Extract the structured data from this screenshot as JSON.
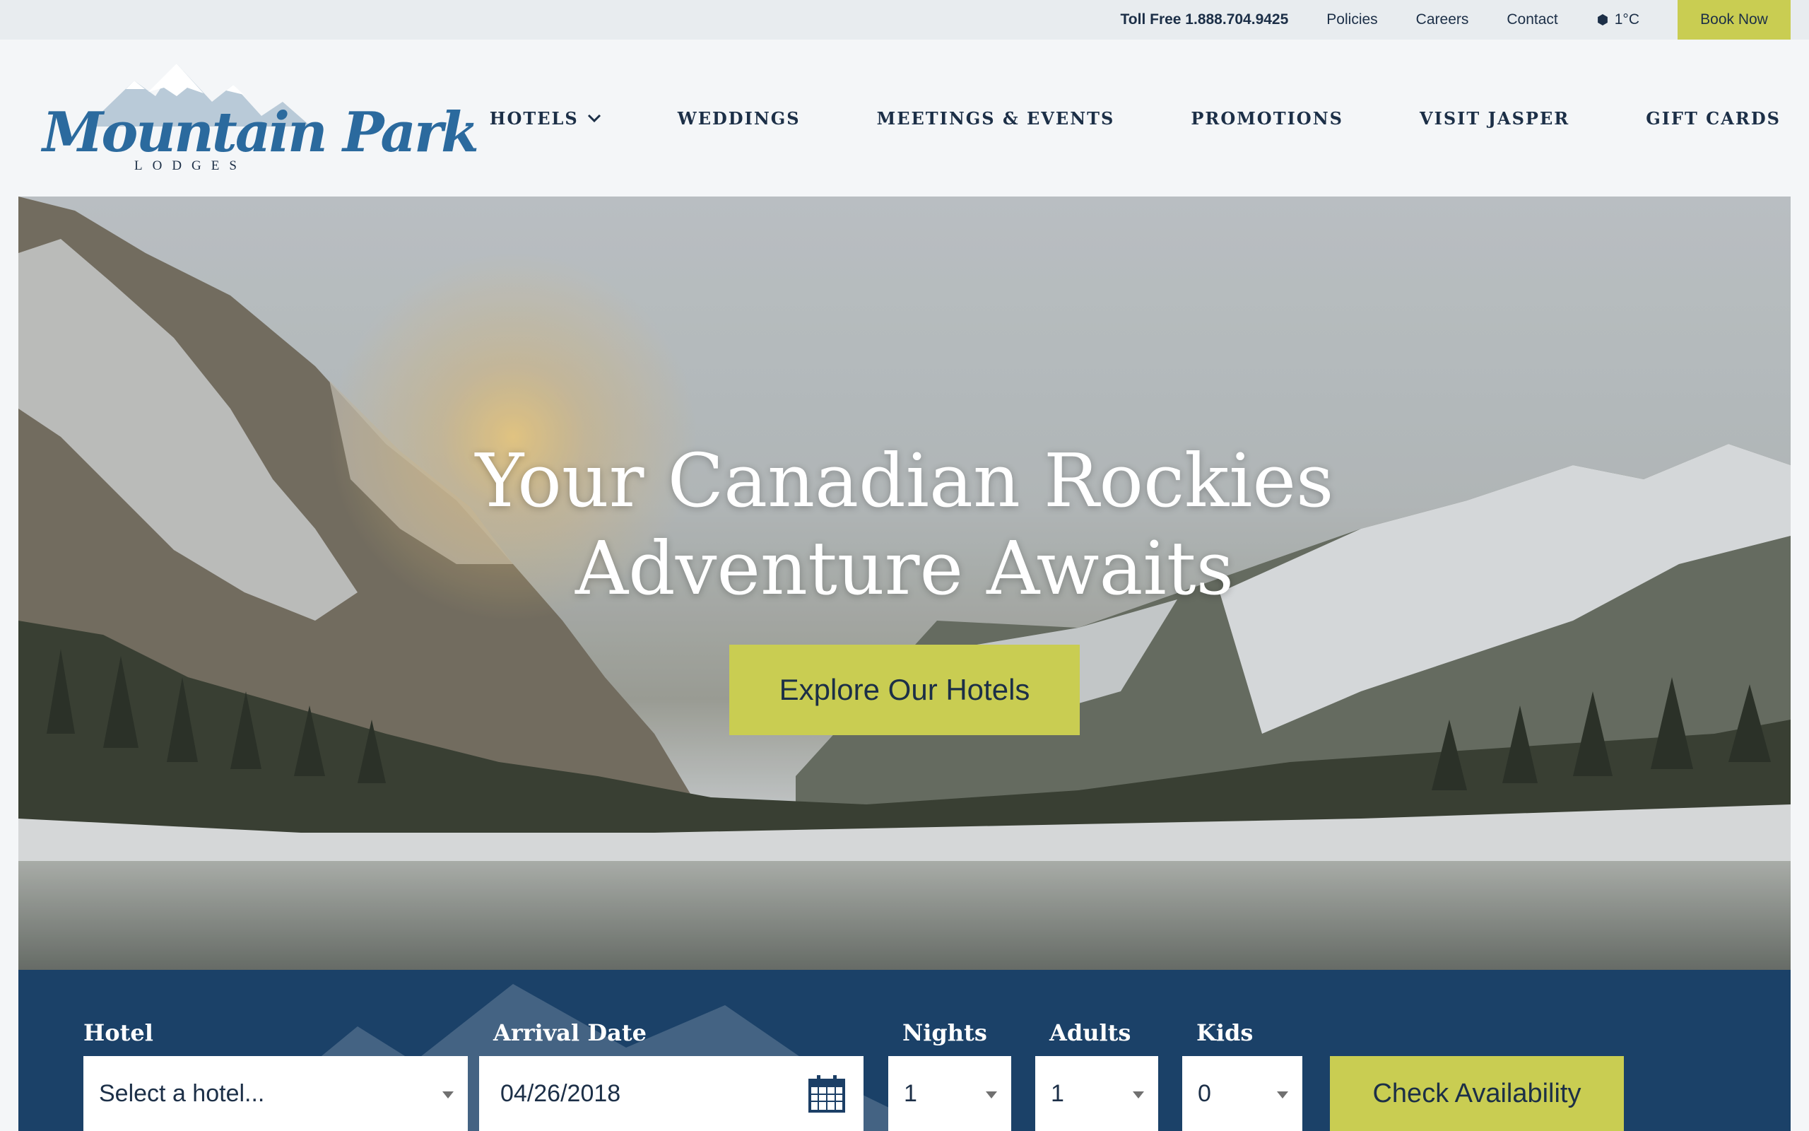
{
  "topbar": {
    "toll_free": "Toll Free 1.888.704.9425",
    "policies": "Policies",
    "careers": "Careers",
    "contact": "Contact",
    "weather": "1°C",
    "book_now": "Book Now"
  },
  "logo": {
    "script": "Mountain Park",
    "sub": "LODGES"
  },
  "nav": {
    "hotels": "HOTELS",
    "weddings": "WEDDINGS",
    "meetings": "MEETINGS & EVENTS",
    "promotions": "PROMOTIONS",
    "visit_jasper": "VISIT JASPER",
    "gift_cards": "GIFT CARDS"
  },
  "hero": {
    "headline_line1": "Your Canadian Rockies",
    "headline_line2": "Adventure Awaits",
    "cta": "Explore Our Hotels"
  },
  "booking": {
    "hotel_label": "Hotel",
    "hotel_value": "Select a hotel...",
    "arrival_label": "Arrival Date",
    "arrival_value": "04/26/2018",
    "nights_label": "Nights",
    "nights_value": "1",
    "adults_label": "Adults",
    "adults_value": "1",
    "kids_label": "Kids",
    "kids_value": "0",
    "check_availability": "Check Availability"
  },
  "colors": {
    "accent": "#c9cd52",
    "navy": "#1c2f47",
    "booking_bg": "#1b4168",
    "logo_blue": "#2b6a9e"
  },
  "icons": [
    "snowflake-icon",
    "chevron-down-icon",
    "calendar-icon",
    "dropdown-caret-icon"
  ]
}
